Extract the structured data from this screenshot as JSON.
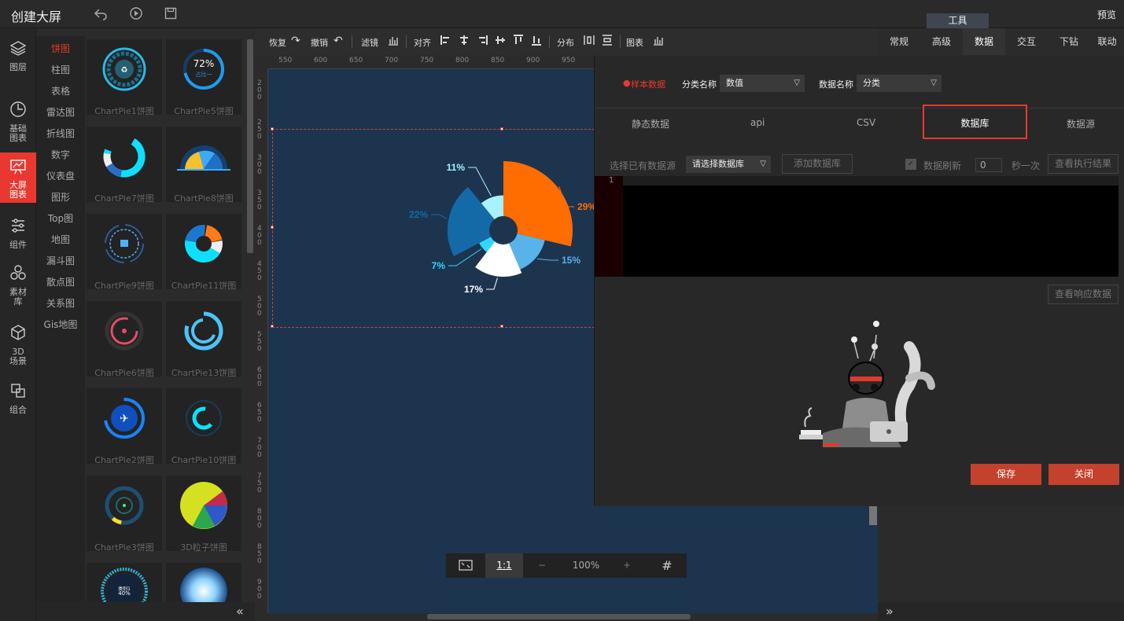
{
  "header": {
    "title": "创建大屏",
    "tool_tab": "工具",
    "preview": "预览"
  },
  "rail": {
    "items": [
      {
        "label": "图层",
        "icon": "layers-icon"
      },
      {
        "label": "基础图表",
        "icon": "pie-clock-icon"
      },
      {
        "label": "大屏图表",
        "icon": "screen-chart-icon"
      },
      {
        "label": "组件",
        "icon": "sliders-icon"
      },
      {
        "label": "素材库",
        "icon": "hexagons-icon"
      },
      {
        "label": "3D场景",
        "icon": "cube-icon"
      },
      {
        "label": "组合",
        "icon": "combine-icon"
      }
    ]
  },
  "categories": [
    "饼图",
    "柱图",
    "表格",
    "雷达图",
    "折线图",
    "数字",
    "仪表盘",
    "图形",
    "Top图",
    "地图",
    "漏斗图",
    "散点图",
    "关系图",
    "Gis地图"
  ],
  "gallery": [
    {
      "label": "ChartPie1饼图"
    },
    {
      "label": "ChartPie5饼图",
      "center": "72%",
      "sub": "占比一"
    },
    {
      "label": "ChartPie7饼图"
    },
    {
      "label": "ChartPie8饼图"
    },
    {
      "label": "ChartPie9饼图"
    },
    {
      "label": "ChartPie11饼图"
    },
    {
      "label": "ChartPie6饼图"
    },
    {
      "label": "ChartPie13饼图"
    },
    {
      "label": "ChartPie2饼图"
    },
    {
      "label": "ChartPie10饼图"
    },
    {
      "label": "ChartPie3饼图"
    },
    {
      "label": "3D粒子饼图"
    },
    {
      "label": "",
      "center": "40%",
      "sub": "类别1"
    },
    {
      "label": ""
    }
  ],
  "toolbar": {
    "redo": "恢复",
    "undo": "撤销",
    "filter": "滤镜",
    "align": "对齐",
    "distribute": "分布",
    "chart": "图表"
  },
  "ruler_top": [
    "550",
    "600",
    "650",
    "700",
    "750",
    "800",
    "850",
    "900",
    "950"
  ],
  "ruler_left": [
    "200",
    "250",
    "300",
    "350",
    "400",
    "450",
    "500",
    "550",
    "600",
    "650",
    "700",
    "750",
    "800",
    "850",
    "900"
  ],
  "chart_data": {
    "type": "pie",
    "subtype": "nightingale-rose",
    "labels": [
      "29%",
      "15%",
      "17%",
      "7%",
      "22%",
      "11%"
    ],
    "values": [
      29,
      15,
      17,
      7,
      22,
      11
    ],
    "colors": [
      "#ff6c00",
      "#58b3e8",
      "#ffffff",
      "#2ed8ff",
      "#146aa6",
      "#a8f1ff"
    ]
  },
  "zoom": {
    "value": "100%",
    "ratio": "1:1",
    "minus": "−",
    "plus": "+"
  },
  "right_tabs": [
    "常规",
    "高级",
    "数据",
    "交互",
    "下钻",
    "联动"
  ],
  "modal": {
    "sample_label": "样本数据",
    "category_name_label": "分类名称",
    "category_name_value": "数值",
    "data_name_label": "数据名称",
    "data_name_value": "分类",
    "tabs": [
      "静态数据",
      "api",
      "CSV",
      "数据库",
      "数据源"
    ],
    "select_source_label": "选择已有数据源",
    "select_source_value": "请选择数据库",
    "add_db": "添加数据库",
    "refresh_label": "数据刷新",
    "refresh_value": "0",
    "refresh_unit": "秒一次",
    "view_exec": "查看执行结果",
    "line_no": "1",
    "view_response": "查看响应数据",
    "save": "保存",
    "close": "关闭"
  },
  "colors": {
    "accent": "#e9382f",
    "canvas": "#1d344f",
    "button": "#c4412e"
  }
}
